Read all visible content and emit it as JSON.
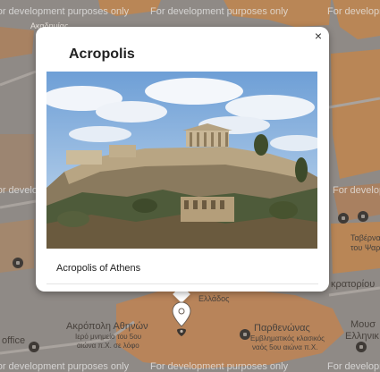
{
  "map": {
    "watermark": "For development purposes only",
    "labels": {
      "top_left": "Ακαδημίας",
      "akropoli_line1": "Ακρόπολη Αθηνών",
      "akropoli_line2": "Ιερό μνημείο του 5ου",
      "akropoli_line3": "αιώνα π.Χ. σε λόφο",
      "parthenon_line1": "Παρθενώνας",
      "parthenon_line2": "Εμβληματικός κλασικός",
      "parthenon_line3": "ναός 5ου αιώνα π.Χ.",
      "right_museum_line1": "Μουσ",
      "right_museum_line2": "Ελληνικ",
      "right_kratorio": "κρατορίου",
      "right_taverna_line1": "Ταβέρνα",
      "right_taverna_line2": "του Ψαρρ",
      "office": "office",
      "ellados": "Ελλάδος"
    },
    "colors": {
      "land": "#8f8a86",
      "highlight": "#b98656",
      "park": "#b8845a"
    }
  },
  "popup": {
    "title": "Acropolis",
    "caption": "Acropolis of Athens",
    "close_label": "×",
    "image_alt": "Acropolis of Athens photo"
  },
  "marker": {
    "icon": "map-pin-icon"
  }
}
